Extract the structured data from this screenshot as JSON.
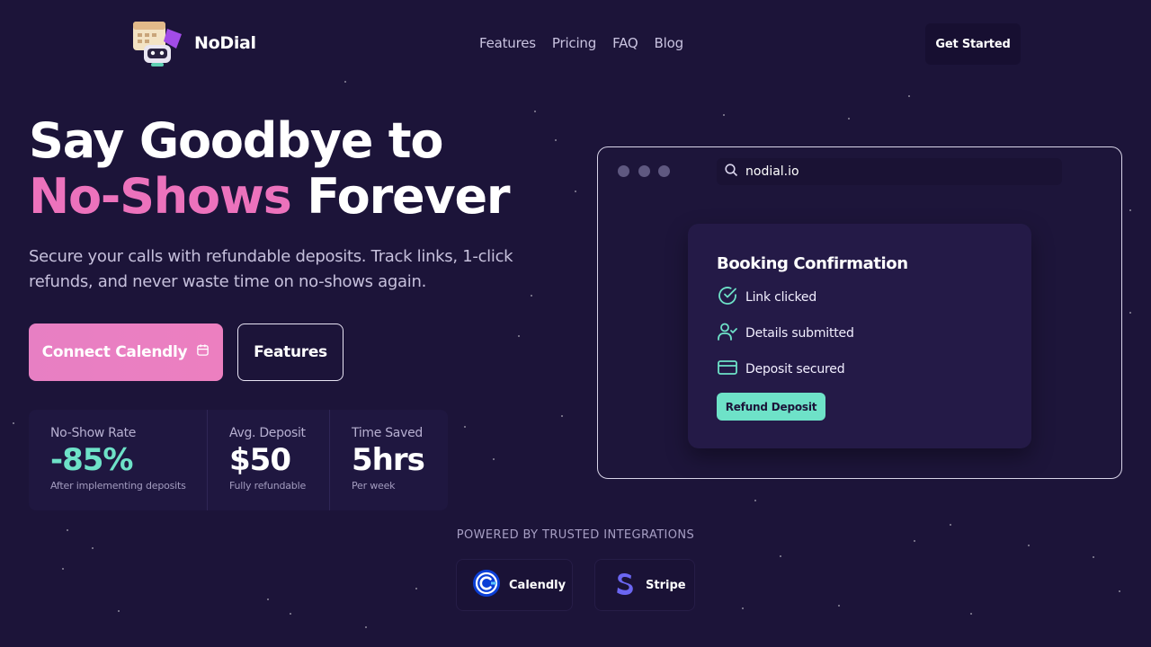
{
  "brand": {
    "name": "NoDial"
  },
  "nav": {
    "items": [
      "Features",
      "Pricing",
      "FAQ",
      "Blog"
    ],
    "cta": "Get Started"
  },
  "hero": {
    "title_line1": "Say Goodbye to",
    "title_highlight": "No-Shows",
    "title_line2_rest": "Forever",
    "subtitle": "Secure your calls with refundable deposits. Track links, 1-click refunds, and never waste time on no-shows again.",
    "primary_cta": "Connect Calendly",
    "secondary_cta": "Features"
  },
  "stats": [
    {
      "label": "No-Show Rate",
      "value": "-85%",
      "note": "After implementing deposits"
    },
    {
      "label": "Avg. Deposit",
      "value": "$50",
      "note": "Fully refundable"
    },
    {
      "label": "Time Saved",
      "value": "5hrs",
      "note": "Per week"
    }
  ],
  "browser": {
    "url": "nodial.io",
    "card": {
      "title": "Booking Confirmation",
      "steps": [
        "Link clicked",
        "Details submitted",
        "Deposit secured"
      ],
      "button": "Refund Deposit"
    }
  },
  "integrations": {
    "heading": "POWERED BY TRUSTED INTEGRATIONS",
    "items": [
      {
        "name": "Calendly",
        "icon": "calendly-icon"
      },
      {
        "name": "Stripe",
        "icon": "stripe-icon"
      }
    ]
  },
  "colors": {
    "background": "#1c1439",
    "pink": "#ec72bc",
    "teal": "#6ee2c8",
    "card": "#241a47"
  }
}
